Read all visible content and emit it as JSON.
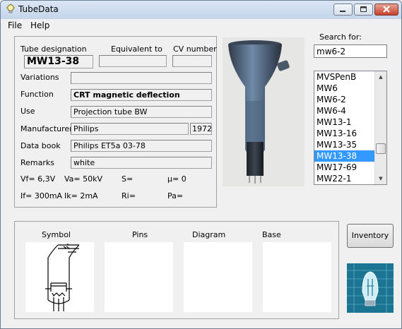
{
  "window": {
    "title": "TubeData"
  },
  "menu": {
    "file": "File",
    "help": "Help"
  },
  "headers": {
    "tube_designation": "Tube designation",
    "equivalent_to": "Equivalent to",
    "cv_number": "CV number"
  },
  "tube": {
    "designation": "MW13-38",
    "equivalent": "",
    "cv_number": "",
    "variations": "",
    "function": "CRT magnetic deflection",
    "use": "Projection tube BW",
    "manufacturer": "Philips",
    "year": "1972",
    "data_book": "Philips ET5a 03-78",
    "remarks": "white"
  },
  "labels": {
    "variations": "Variations",
    "function": "Function",
    "use": "Use",
    "manufacturer": "Manufacturer",
    "data_book": "Data book",
    "remarks": "Remarks"
  },
  "params": {
    "vf": "Vf= 6,3V",
    "va": "Va= 50kV",
    "s": "S=",
    "mu": "µ=   0",
    "if": "If= 300mA",
    "ik": "Ik=  2mA",
    "ri": "Ri=",
    "pa": "Pa="
  },
  "search": {
    "label": "Search for:",
    "value": "mw6-2"
  },
  "tube_list": {
    "items": [
      "MVSPenB",
      "MW6",
      "MW6-2",
      "MW6-4",
      "MW13-1",
      "MW13-16",
      "MW13-35",
      "MW13-38",
      "MW17-69",
      "MW22-1"
    ],
    "selected": "MW13-38"
  },
  "panes": {
    "symbol": "Symbol",
    "pins": "Pins",
    "diagram": "Diagram",
    "base": "Base"
  },
  "buttons": {
    "inventory": "Inventory"
  }
}
